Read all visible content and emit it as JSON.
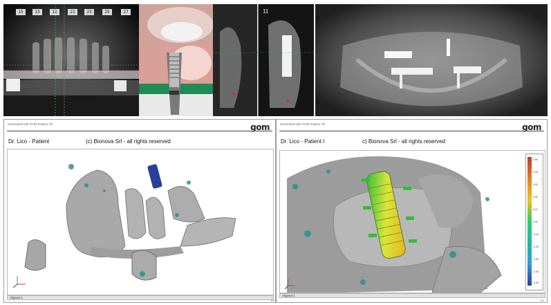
{
  "top_strip": {
    "ct_scan": {
      "tooth_labels": [
        "15",
        "13",
        "11",
        "21",
        "23",
        "25",
        "27"
      ]
    },
    "ct_cross_section": {
      "labels": [
        "11"
      ]
    }
  },
  "left_report": {
    "generated_by": "Generated with GOM Inspect V8",
    "logo": "gom",
    "patient": "Dr. Lico - Patient",
    "copyright": "(c) Bionova Srl - all rights reserved",
    "status": "Aligned 1",
    "page": "1/3"
  },
  "right_report": {
    "generated_by": "Generated with GOM Inspect V8",
    "logo": "gom",
    "patient": "Dr. Lico - Patient I",
    "copyright": "c) Bionova Srl - all rights reserved",
    "status": "Aligned 1",
    "page": "2/3",
    "scale_labels": [
      "0.50",
      "0.40",
      "0.30",
      "0.20",
      "0.10",
      "0.00",
      "-0.10",
      "-0.20",
      "-0.30",
      "-0.40",
      "-0.50"
    ]
  },
  "colors": {
    "bone_grey": "#a8a8a8",
    "implant_blue": "#2a3f9a",
    "teal_tissue": "#2f8f8f"
  }
}
